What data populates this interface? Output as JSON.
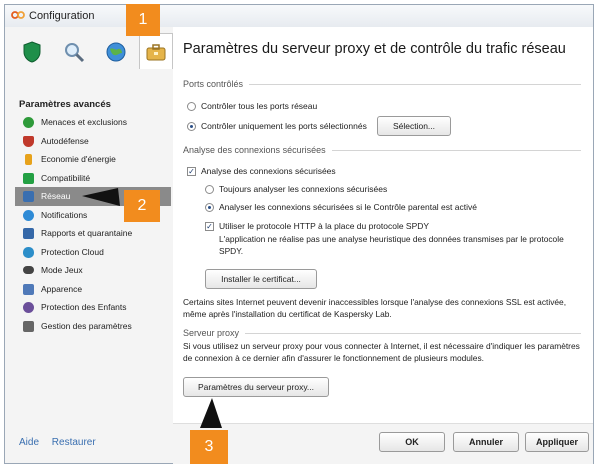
{
  "window": {
    "title": "Configuration"
  },
  "sidebar": {
    "heading": "Paramètres avancés",
    "items": [
      {
        "label": "Menaces et exclusions",
        "icon": "check-circle-icon",
        "color": "#2e9a3a"
      },
      {
        "label": "Autodéfense",
        "icon": "shield-icon",
        "color": "#c0392b"
      },
      {
        "label": "Economie d'énergie",
        "icon": "battery-icon",
        "color": "#e7a21b"
      },
      {
        "label": "Compatibilité",
        "icon": "compatibility-icon",
        "color": "#23a043"
      },
      {
        "label": "Réseau",
        "icon": "network-icon",
        "color": "#3a6fb0"
      },
      {
        "label": "Notifications",
        "icon": "info-icon",
        "color": "#2f8bd6"
      },
      {
        "label": "Rapports et quarantaine",
        "icon": "reports-icon",
        "color": "#3568a8"
      },
      {
        "label": "Protection Cloud",
        "icon": "cloud-icon",
        "color": "#2c8ec9"
      },
      {
        "label": "Mode Jeux",
        "icon": "gamepad-icon",
        "color": "#444444"
      },
      {
        "label": "Apparence",
        "icon": "appearance-icon",
        "color": "#4f79b8"
      },
      {
        "label": "Protection des Enfants",
        "icon": "parental-icon",
        "color": "#6b4f9a"
      },
      {
        "label": "Gestion des paramètres",
        "icon": "settings-file-icon",
        "color": "#666666"
      }
    ],
    "selected_index": 4,
    "footer": {
      "help": "Aide",
      "restore": "Restaurer"
    }
  },
  "main": {
    "title": "Paramètres du serveur proxy et de contrôle du trafic réseau",
    "ports_group": "Ports contrôlés",
    "ports_all": "Contrôler tous les ports réseau",
    "ports_selected": "Contrôler uniquement les ports sélectionnés",
    "selection_button": "Sélection...",
    "ssl_group": "Analyse des connexions sécurisées",
    "ssl_check": "Analyse des connexions sécurisées",
    "ssl_always": "Toujours analyser les connexions sécurisées",
    "ssl_parental": "Analyser les connexions sécurisées si le Contrôle parental est activé",
    "spdy_check": "Utiliser le protocole HTTP à la place du protocole SPDY",
    "spdy_note": "L'application ne réalise pas une analyse heuristique des données transmises par le protocole SPDY.",
    "install_cert_button": "Installer le certificat...",
    "ssl_note": "Certains sites Internet peuvent devenir inaccessibles lorsque l'analyse des connexions SSL est activée, même après l'installation du certificat de Kaspersky Lab.",
    "proxy_group": "Serveur proxy",
    "proxy_note": "Si vous utilisez un serveur proxy pour vous connecter à Internet, il est nécessaire d'indiquer les paramètres de connexion à ce dernier afin d'assurer le fonctionnement de plusieurs modules.",
    "proxy_button": "Paramètres du serveur proxy..."
  },
  "buttons": {
    "ok": "OK",
    "cancel": "Annuler",
    "apply": "Appliquer"
  },
  "callouts": [
    "1",
    "2",
    "3"
  ],
  "colors": {
    "accent": "#f28c1e",
    "selected": "#8a8a8a",
    "link": "#3a6fb0"
  }
}
